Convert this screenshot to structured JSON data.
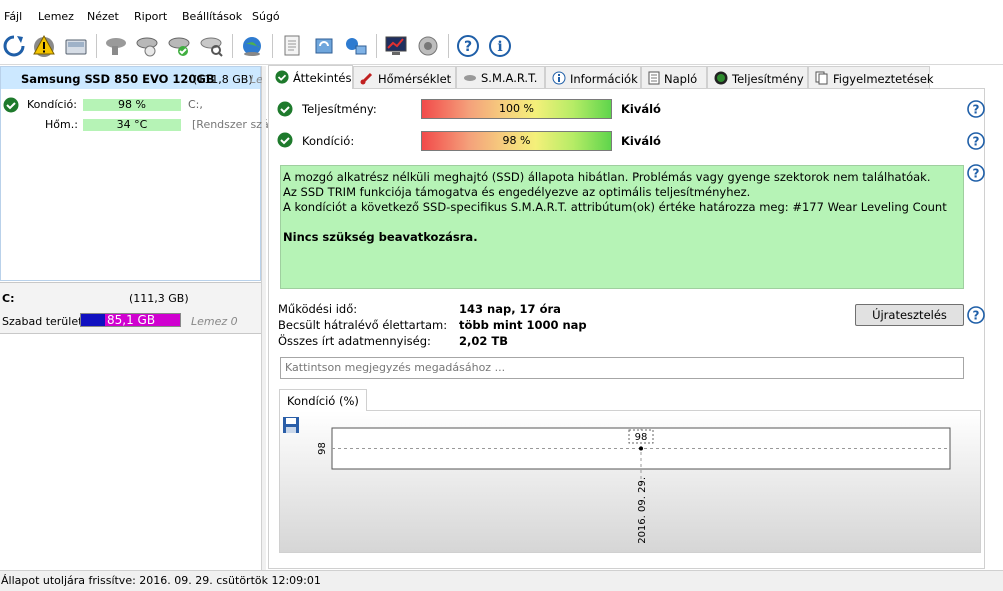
{
  "menu": [
    "Fájl",
    "Lemez",
    "Nézet",
    "Riport",
    "Beállítások",
    "Súgó"
  ],
  "toolbar": {
    "icons": [
      "refresh-icon",
      "warning-icon",
      "disk-icon",
      "disk-gray-icon",
      "disk-check-icon",
      "disk-check2-icon",
      "disk-search-icon",
      "globe-icon",
      "document-icon",
      "sync-icon",
      "network-icon",
      "monitor-chart-icon",
      "speaker-icon",
      "help-icon",
      "info-icon"
    ]
  },
  "disk": {
    "title": "Samsung SSD 850 EVO 120GB",
    "size": "(111,8 GB)",
    "extra": "Le",
    "health_label": "Kondíció:",
    "health_value": "98 %",
    "drive_letter": "C:,",
    "temp_label": "Hőm.:",
    "temp_value": "34 °C",
    "temp_note": "[Rendszer szá"
  },
  "volume": {
    "letter": "C:",
    "size": "(111,3 GB)",
    "free_label": "Szabad terület",
    "free_value": "85,1 GB",
    "free_fraction": 0.24,
    "lemez": "Lemez 0"
  },
  "tabs": [
    "Áttekintés",
    "Hőmérséklet",
    "S.M.A.R.T.",
    "Információk",
    "Napló",
    "Teljesítmény",
    "Figyelmeztetések"
  ],
  "overview": {
    "performance_label": "Teljesítmény:",
    "performance_value": "100 %",
    "performance_rating": "Kiváló",
    "health_label": "Kondíció:",
    "health_value": "98 %",
    "health_rating": "Kiváló",
    "info_lines": [
      "A mozgó alkatrész nélküli meghajtó (SSD) állapota hibátlan. Problémás vagy gyenge szektorok nem találhatóak.",
      "Az SSD TRIM funkciója támogatva és engedélyezve az optimális teljesítményhez.",
      "A kondíciót a következő SSD-specifikus S.M.A.R.T. attribútum(ok) értéke határozza meg:  #177 Wear Leveling Count"
    ],
    "action_text": "Nincs szükség beavatkozásra.",
    "uptime_label": "Működési idő:",
    "uptime_value": "143 nap, 17 óra",
    "remaining_label": "Becsült hátralévő élettartam:",
    "remaining_value": "több mint 1000 nap",
    "written_label": "Összes írt adatmennyiség:",
    "written_value": "2,02 TB",
    "retest_button": "Újratesztelés",
    "note_placeholder": "Kattintson megjegyzés megadásához ..."
  },
  "chart_tab": "Kondíció  (%)",
  "chart_data": {
    "type": "line",
    "x": [
      "2016. 09. 29."
    ],
    "values": [
      98
    ],
    "y_tick": "98",
    "point_label": "98"
  },
  "status": "Állapot utoljára frissítve: 2016. 09. 29. csütörtök 12:09:01"
}
